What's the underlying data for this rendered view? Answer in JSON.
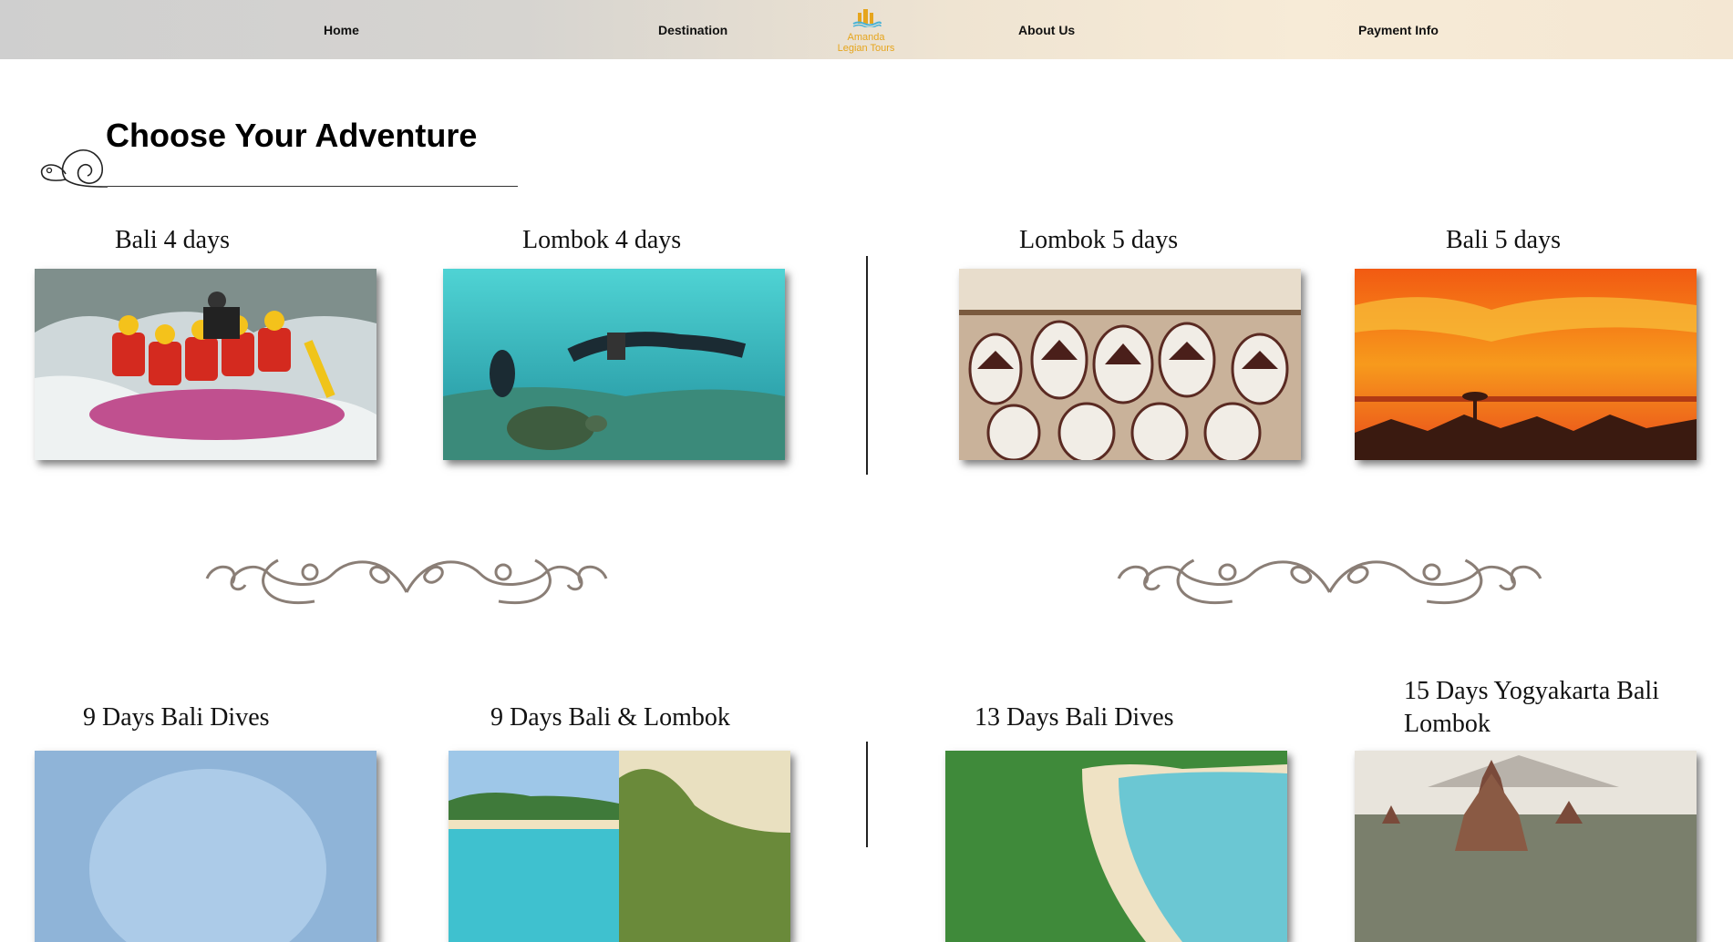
{
  "nav": {
    "home": "Home",
    "destination": "Destination",
    "about": "About Us",
    "payment": "Payment Info",
    "logo_line1": "Amanda",
    "logo_line2": "Legian Tours"
  },
  "section": {
    "title": "Choose Your Adventure"
  },
  "tours": [
    {
      "title": "Bali 4 days",
      "image": "rafting"
    },
    {
      "title": "Lombok 4 days",
      "image": "diving-turtle"
    },
    {
      "title": "Lombok 5 days",
      "image": "pottery"
    },
    {
      "title": "Bali 5 days",
      "image": "sunset-beach"
    },
    {
      "title": "9 Days Bali Dives",
      "image": "sky-sea"
    },
    {
      "title": "9 Days Bali & Lombok",
      "image": "beach-hills"
    },
    {
      "title": "13 Days Bali Dives",
      "image": "resort-beach"
    },
    {
      "title": "15 Days Yogyakarta Bali Lombok",
      "image": "temple"
    }
  ],
  "colors": {
    "accent": "#e6a51d",
    "ornament": "#8a7e76"
  }
}
